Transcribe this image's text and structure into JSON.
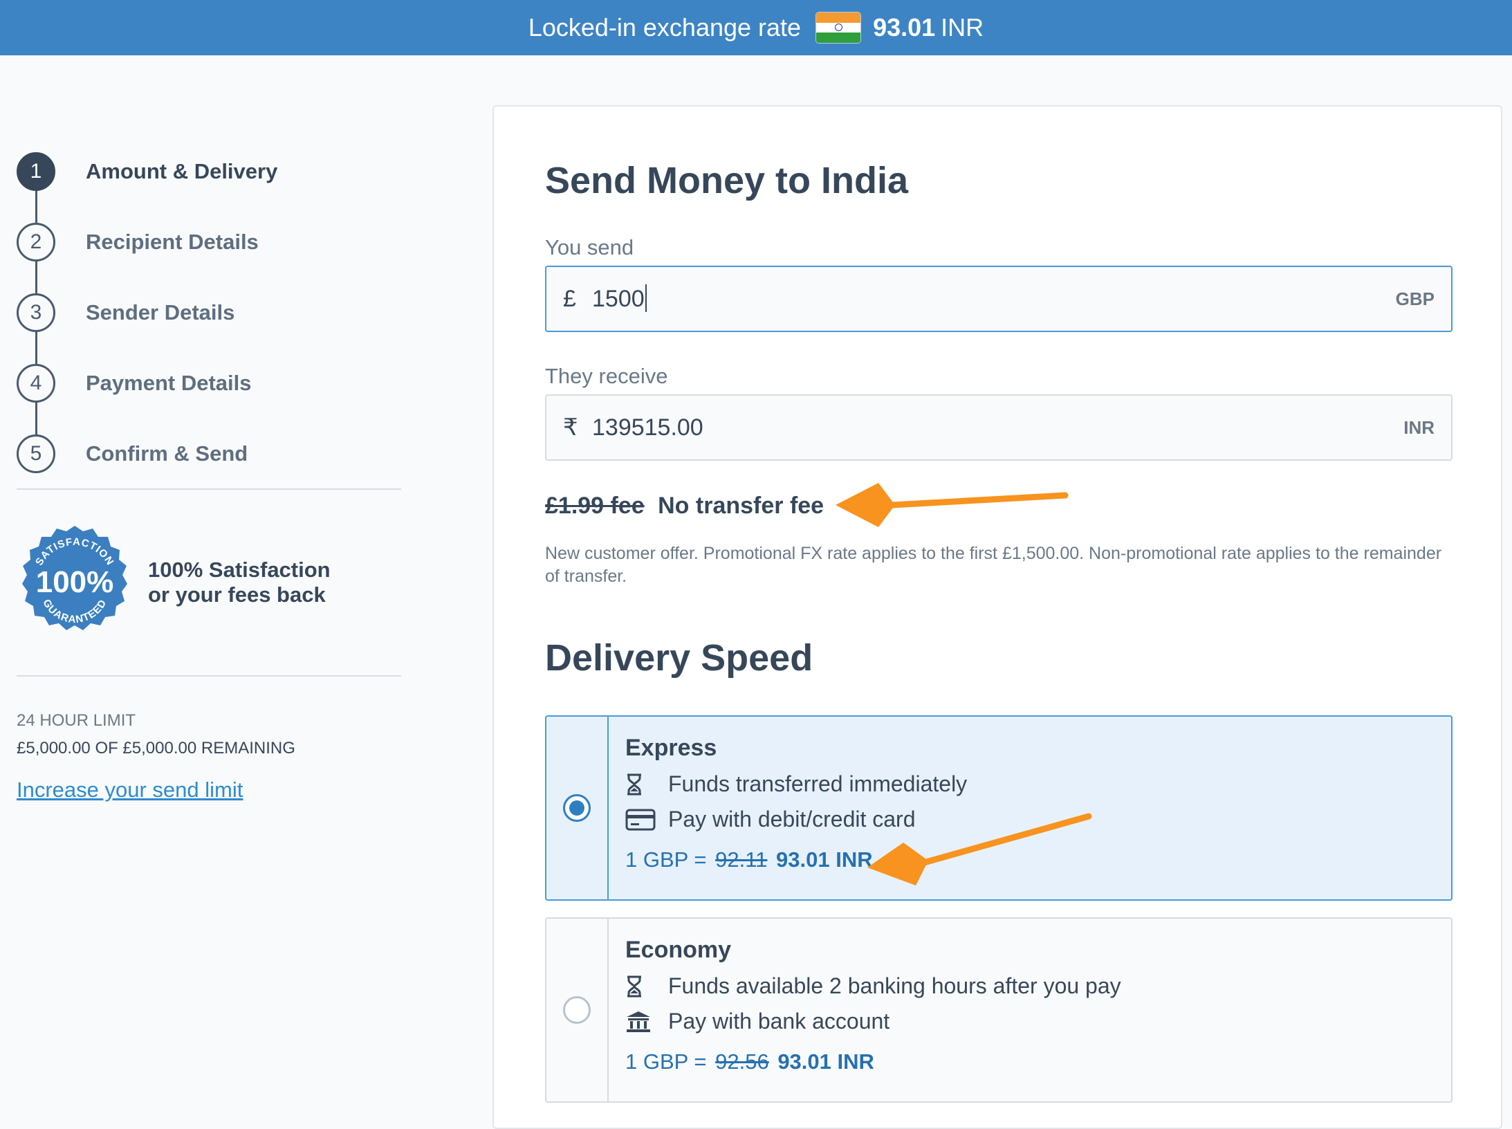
{
  "banner": {
    "text": "Locked-in exchange rate",
    "rate_value": "93.01",
    "rate_currency": "INR",
    "flag_icon": "india-flag-icon"
  },
  "sidebar": {
    "steps": [
      {
        "number": "1",
        "label": "Amount & Delivery",
        "active": true
      },
      {
        "number": "2",
        "label": "Recipient Details",
        "active": false
      },
      {
        "number": "3",
        "label": "Sender Details",
        "active": false
      },
      {
        "number": "4",
        "label": "Payment Details",
        "active": false
      },
      {
        "number": "5",
        "label": "Confirm & Send",
        "active": false
      }
    ],
    "badge": {
      "top": "SATISFACTION",
      "center": "100%",
      "bottom": "GUARANTEED"
    },
    "guarantee_line1": "100% Satisfaction",
    "guarantee_line2": "or your fees back",
    "limit_title": "24 HOUR LIMIT",
    "limit_value": "£5,000.00 OF £5,000.00 REMAINING",
    "limit_link": "Increase your send limit"
  },
  "main": {
    "title": "Send Money to India",
    "send": {
      "label": "You send",
      "symbol": "£",
      "amount": "1500",
      "currency": "GBP"
    },
    "receive": {
      "label": "They receive",
      "symbol": "₹",
      "amount": "139515.00",
      "currency": "INR"
    },
    "fee_old": "£1.99 fee",
    "fee_new": "No transfer fee",
    "offer": "New customer offer. Promotional FX rate applies to the first £1,500.00. Non-promotional rate applies to the remainder of transfer.",
    "speed_title": "Delivery Speed",
    "options": [
      {
        "name": "Express",
        "selected": true,
        "line1": "Funds transferred immediately",
        "line1_icon": "hourglass-icon",
        "line2": "Pay with debit/credit card",
        "line2_icon": "credit-card-icon",
        "rate_prefix": "1 GBP =",
        "rate_old": "92.11",
        "rate_new": "93.01 INR"
      },
      {
        "name": "Economy",
        "selected": false,
        "line1": "Funds available 2 banking hours after you pay",
        "line1_icon": "hourglass-icon",
        "line2": "Pay with bank account",
        "line2_icon": "bank-icon",
        "rate_prefix": "1 GBP =",
        "rate_old": "92.56",
        "rate_new": "93.01 INR"
      }
    ]
  },
  "colors": {
    "banner": "#3d84c4",
    "accent": "#2e7fc0",
    "text": "#37475a",
    "annotation_arrow": "#f7931e"
  }
}
